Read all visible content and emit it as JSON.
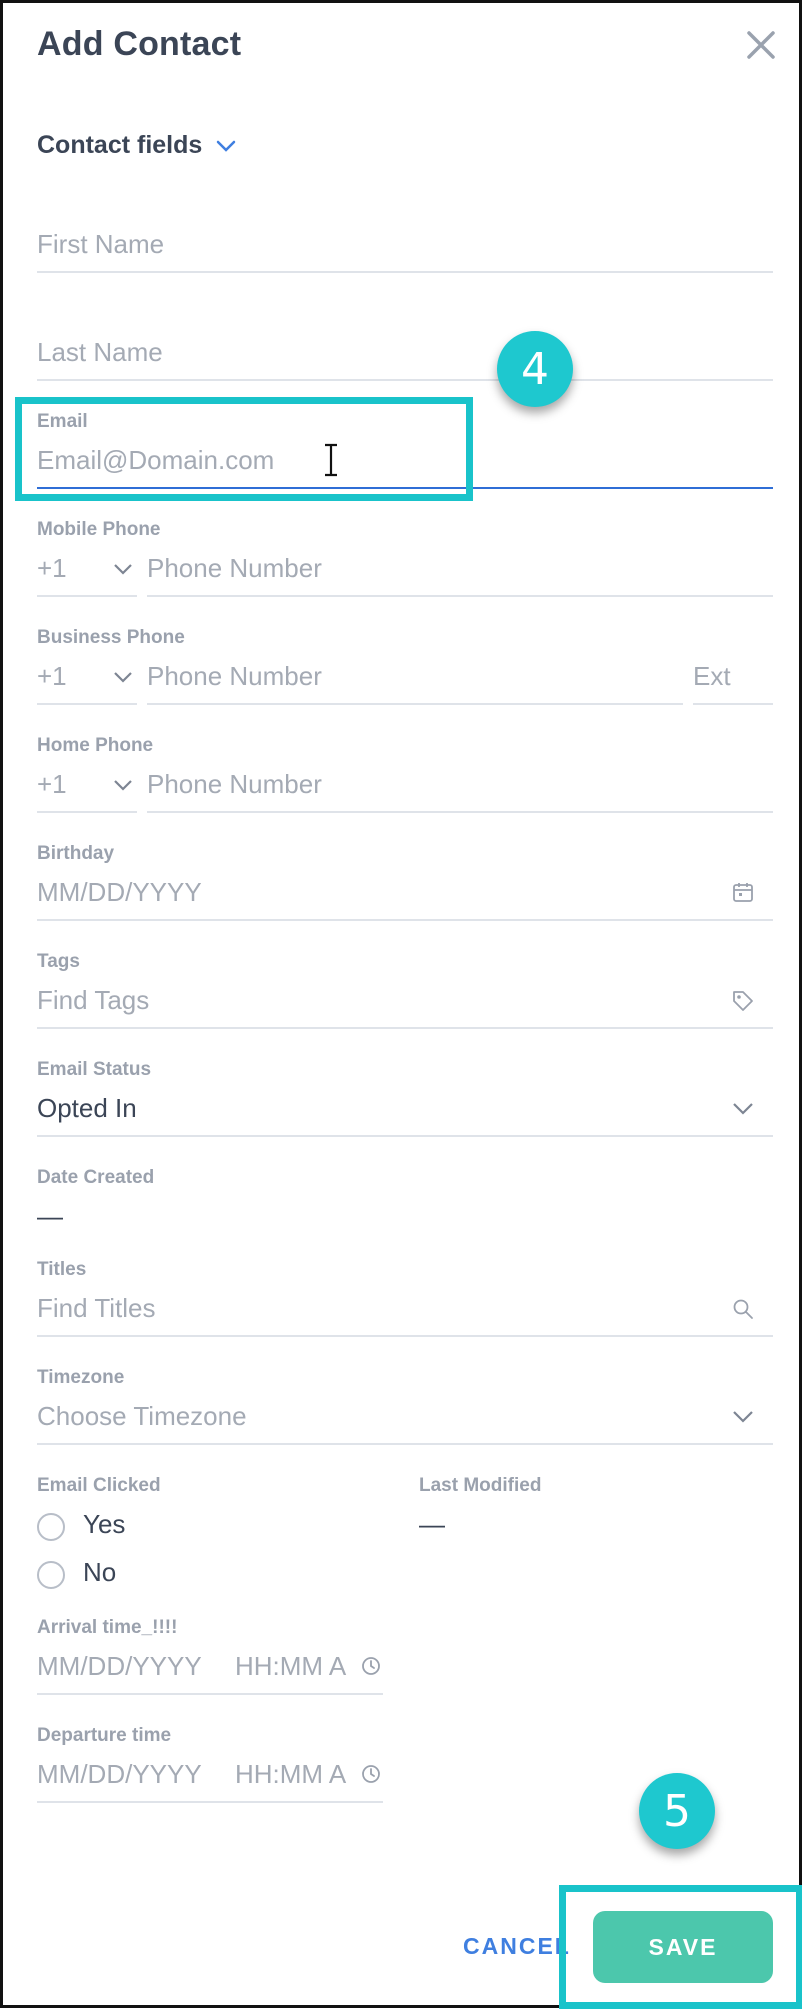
{
  "dialog": {
    "title": "Add Contact"
  },
  "section": {
    "label": "Contact fields"
  },
  "fields": {
    "first_name": {
      "placeholder": "First Name"
    },
    "last_name": {
      "placeholder": "Last Name"
    },
    "email": {
      "label": "Email",
      "placeholder": "Email@Domain.com"
    },
    "mobile_phone": {
      "label": "Mobile Phone",
      "country_code": "+1",
      "placeholder": "Phone Number"
    },
    "business_phone": {
      "label": "Business Phone",
      "country_code": "+1",
      "placeholder": "Phone Number",
      "ext_placeholder": "Ext"
    },
    "home_phone": {
      "label": "Home Phone",
      "country_code": "+1",
      "placeholder": "Phone Number"
    },
    "birthday": {
      "label": "Birthday",
      "placeholder": "MM/DD/YYYY"
    },
    "tags": {
      "label": "Tags",
      "placeholder": "Find Tags"
    },
    "email_status": {
      "label": "Email Status",
      "value": "Opted In"
    },
    "date_created": {
      "label": "Date Created",
      "value": "—"
    },
    "titles": {
      "label": "Titles",
      "placeholder": "Find Titles"
    },
    "timezone": {
      "label": "Timezone",
      "placeholder": "Choose Timezone"
    },
    "email_clicked": {
      "label": "Email Clicked",
      "options": [
        "Yes",
        "No"
      ]
    },
    "last_modified": {
      "label": "Last Modified",
      "value": "—"
    },
    "arrival_time": {
      "label": "Arrival time_!!!!",
      "date_placeholder": "MM/DD/YYYY",
      "time_placeholder": "HH:MM A"
    },
    "departure_time": {
      "label": "Departure time",
      "date_placeholder": "MM/DD/YYYY",
      "time_placeholder": "HH:MM A"
    }
  },
  "actions": {
    "cancel_label": "CANCEL",
    "save_label": "SAVE"
  },
  "annotations": {
    "step_4": "4",
    "step_5": "5"
  },
  "colors": {
    "accent_blue": "#2f6ed6",
    "save_green": "#4cc7ac",
    "callout_cyan": "#1ec8cf"
  }
}
